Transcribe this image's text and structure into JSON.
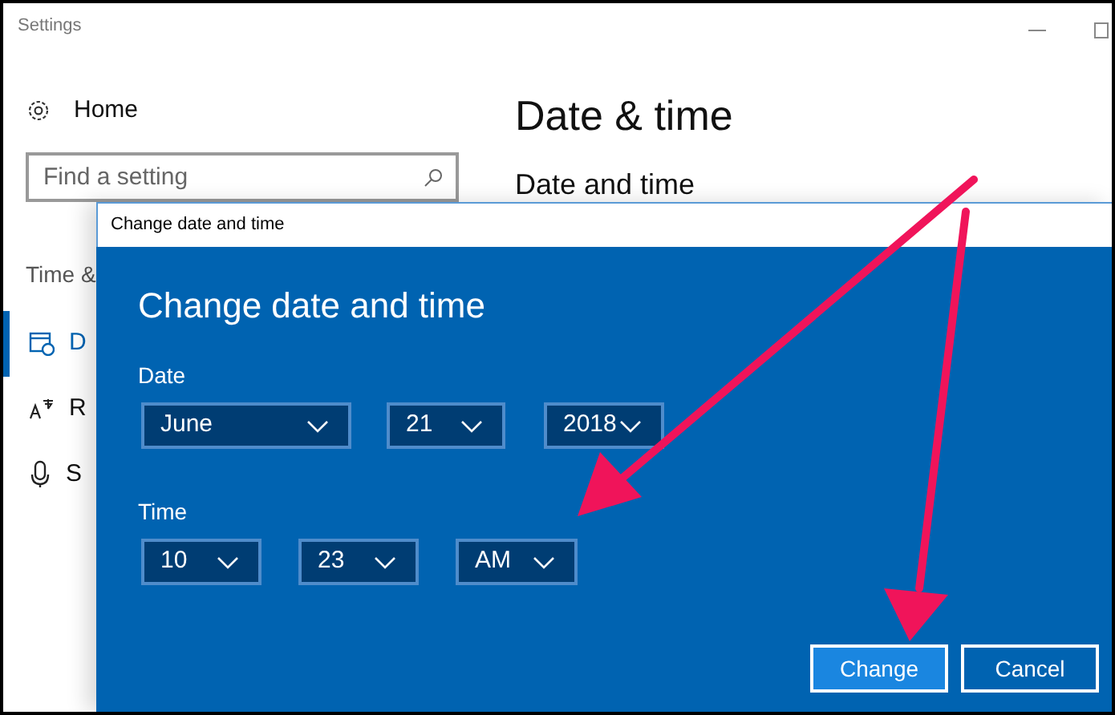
{
  "window": {
    "title": "Settings"
  },
  "sidebar": {
    "home": "Home",
    "search": {
      "placeholder": "Find a setting"
    },
    "section": "Time &",
    "items": [
      {
        "label": "D",
        "kind": "calendar",
        "selected": true
      },
      {
        "label": "R",
        "kind": "language",
        "selected": false
      },
      {
        "label": "S",
        "kind": "microphone",
        "selected": false
      }
    ]
  },
  "content": {
    "title": "Date & time",
    "subtitle": "Date and time"
  },
  "dialog": {
    "title": "Change date and time",
    "heading": "Change date and time",
    "date_label": "Date",
    "date_fields": [
      "June",
      "21",
      "2018"
    ],
    "time_label": "Time",
    "time_fields": [
      "10",
      "23",
      "AM"
    ],
    "buttons": [
      {
        "label": "Change",
        "kind": "primary"
      },
      {
        "label": "Cancel",
        "kind": "secondary"
      }
    ]
  }
}
